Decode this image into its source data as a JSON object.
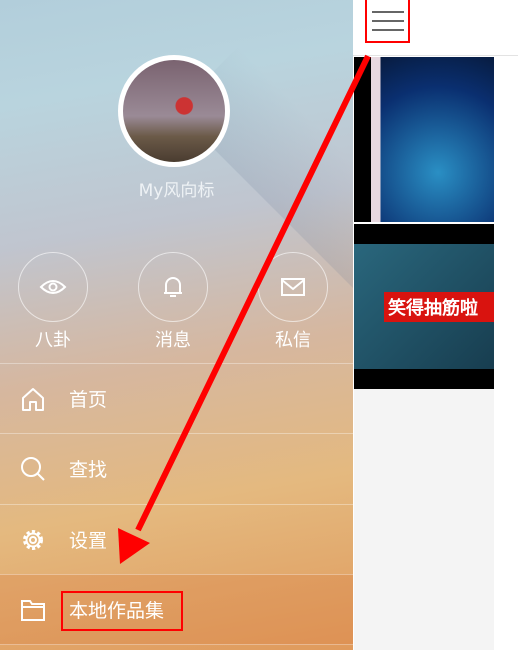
{
  "drawer": {
    "username": "My风向标",
    "quick_actions": [
      {
        "label": "八卦",
        "icon": "eye-icon"
      },
      {
        "label": "消息",
        "icon": "bell-icon"
      },
      {
        "label": "私信",
        "icon": "mail-icon"
      }
    ],
    "menu": [
      {
        "label": "首页",
        "icon": "home-icon"
      },
      {
        "label": "查找",
        "icon": "search-icon"
      },
      {
        "label": "设置",
        "icon": "gear-icon"
      },
      {
        "label": "本地作品集",
        "icon": "folder-icon",
        "highlighted": true
      }
    ]
  },
  "content": {
    "thumbnails": [
      {
        "caption": ""
      },
      {
        "caption": "笑得抽筋啦"
      }
    ]
  },
  "annotation": {
    "color": "#ff0000"
  }
}
